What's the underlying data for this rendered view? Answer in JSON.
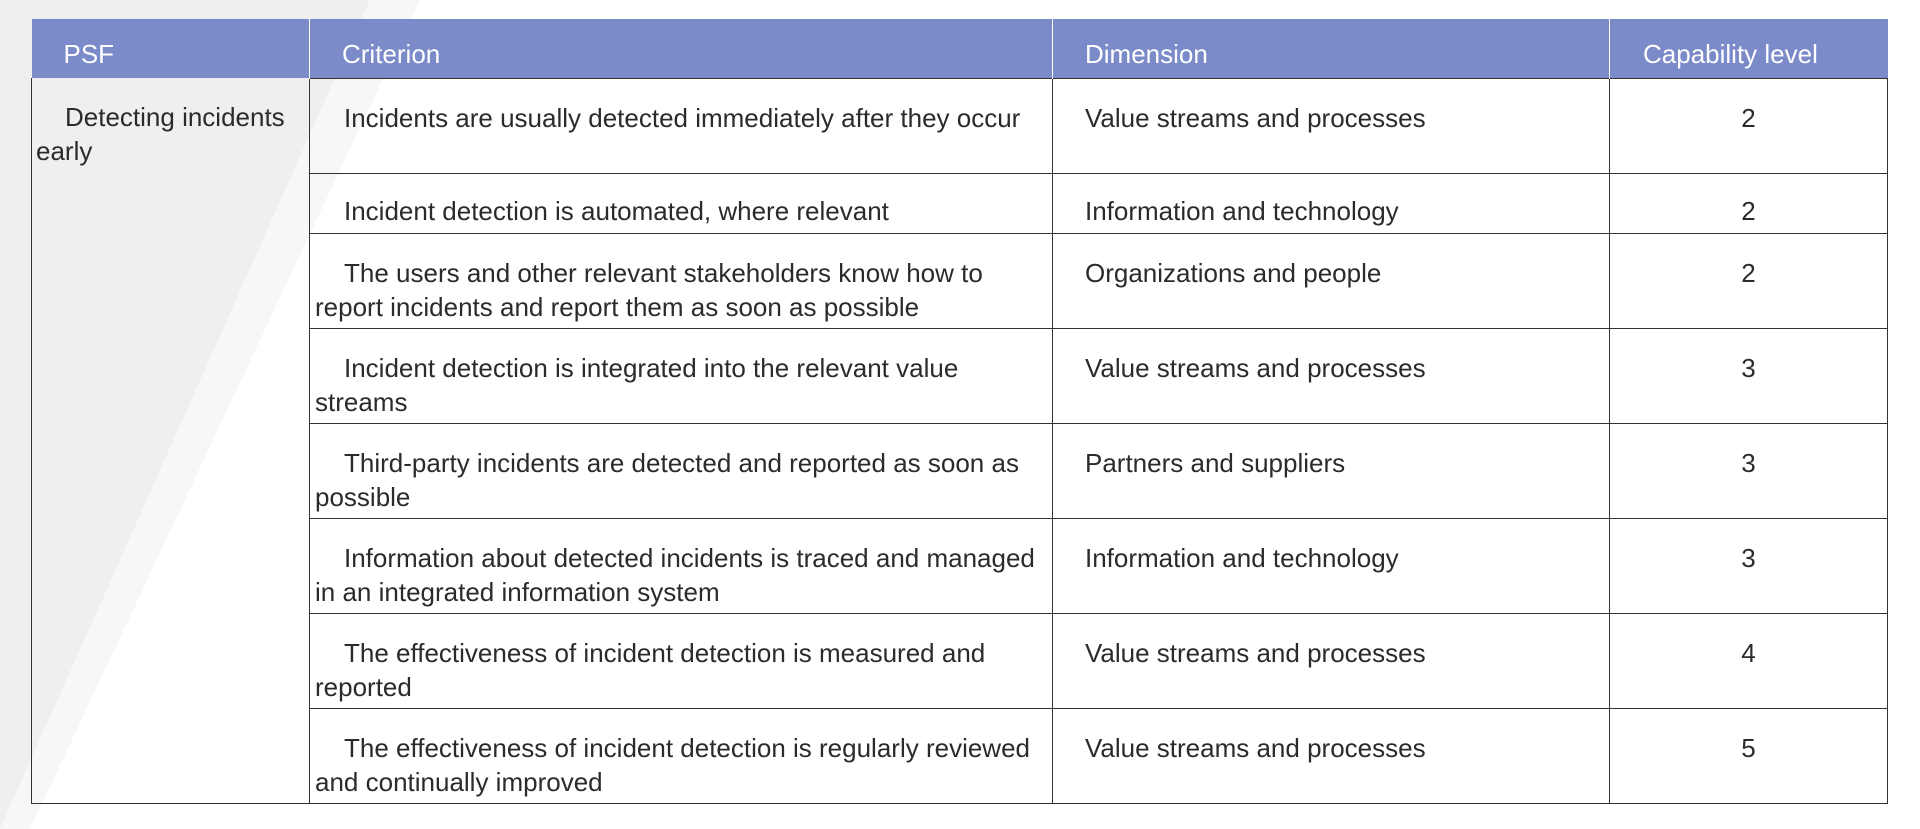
{
  "table": {
    "headers": {
      "psf": "PSF",
      "criterion": "Criterion",
      "dimension": "Dimension",
      "capability_level": "Capability level"
    },
    "psf_value": "Detecting incidents early",
    "rows": [
      {
        "criterion": "Incidents are usually detected immediately after they occur",
        "dimension": "Value streams and processes",
        "level": "2"
      },
      {
        "criterion": "Incident detection is automated, where relevant",
        "dimension": "Information and technology",
        "level": "2"
      },
      {
        "criterion": "The users and other relevant stakeholders know how to report incidents and report them as soon as possible",
        "dimension": "Organizations and people",
        "level": "2"
      },
      {
        "criterion": "Incident detection is integrated into the relevant value streams",
        "dimension": "Value streams and processes",
        "level": "3"
      },
      {
        "criterion": "Third-party incidents are detected and reported as soon as possible",
        "dimension": "Partners and suppliers",
        "level": "3"
      },
      {
        "criterion": "Information about detected incidents is traced and managed in an integrated information system",
        "dimension": "Information and technology",
        "level": "3"
      },
      {
        "criterion": "The effectiveness of incident detection is measured and reported",
        "dimension": "Value streams and processes",
        "level": "4"
      },
      {
        "criterion": "The effectiveness of incident detection is regularly reviewed and continually improved",
        "dimension": "Value streams and processes",
        "level": "5"
      }
    ]
  },
  "colors": {
    "header_bg": "#7b8ac9",
    "header_text": "#ffffff",
    "border": "#333333",
    "text": "#2b2b2b"
  }
}
